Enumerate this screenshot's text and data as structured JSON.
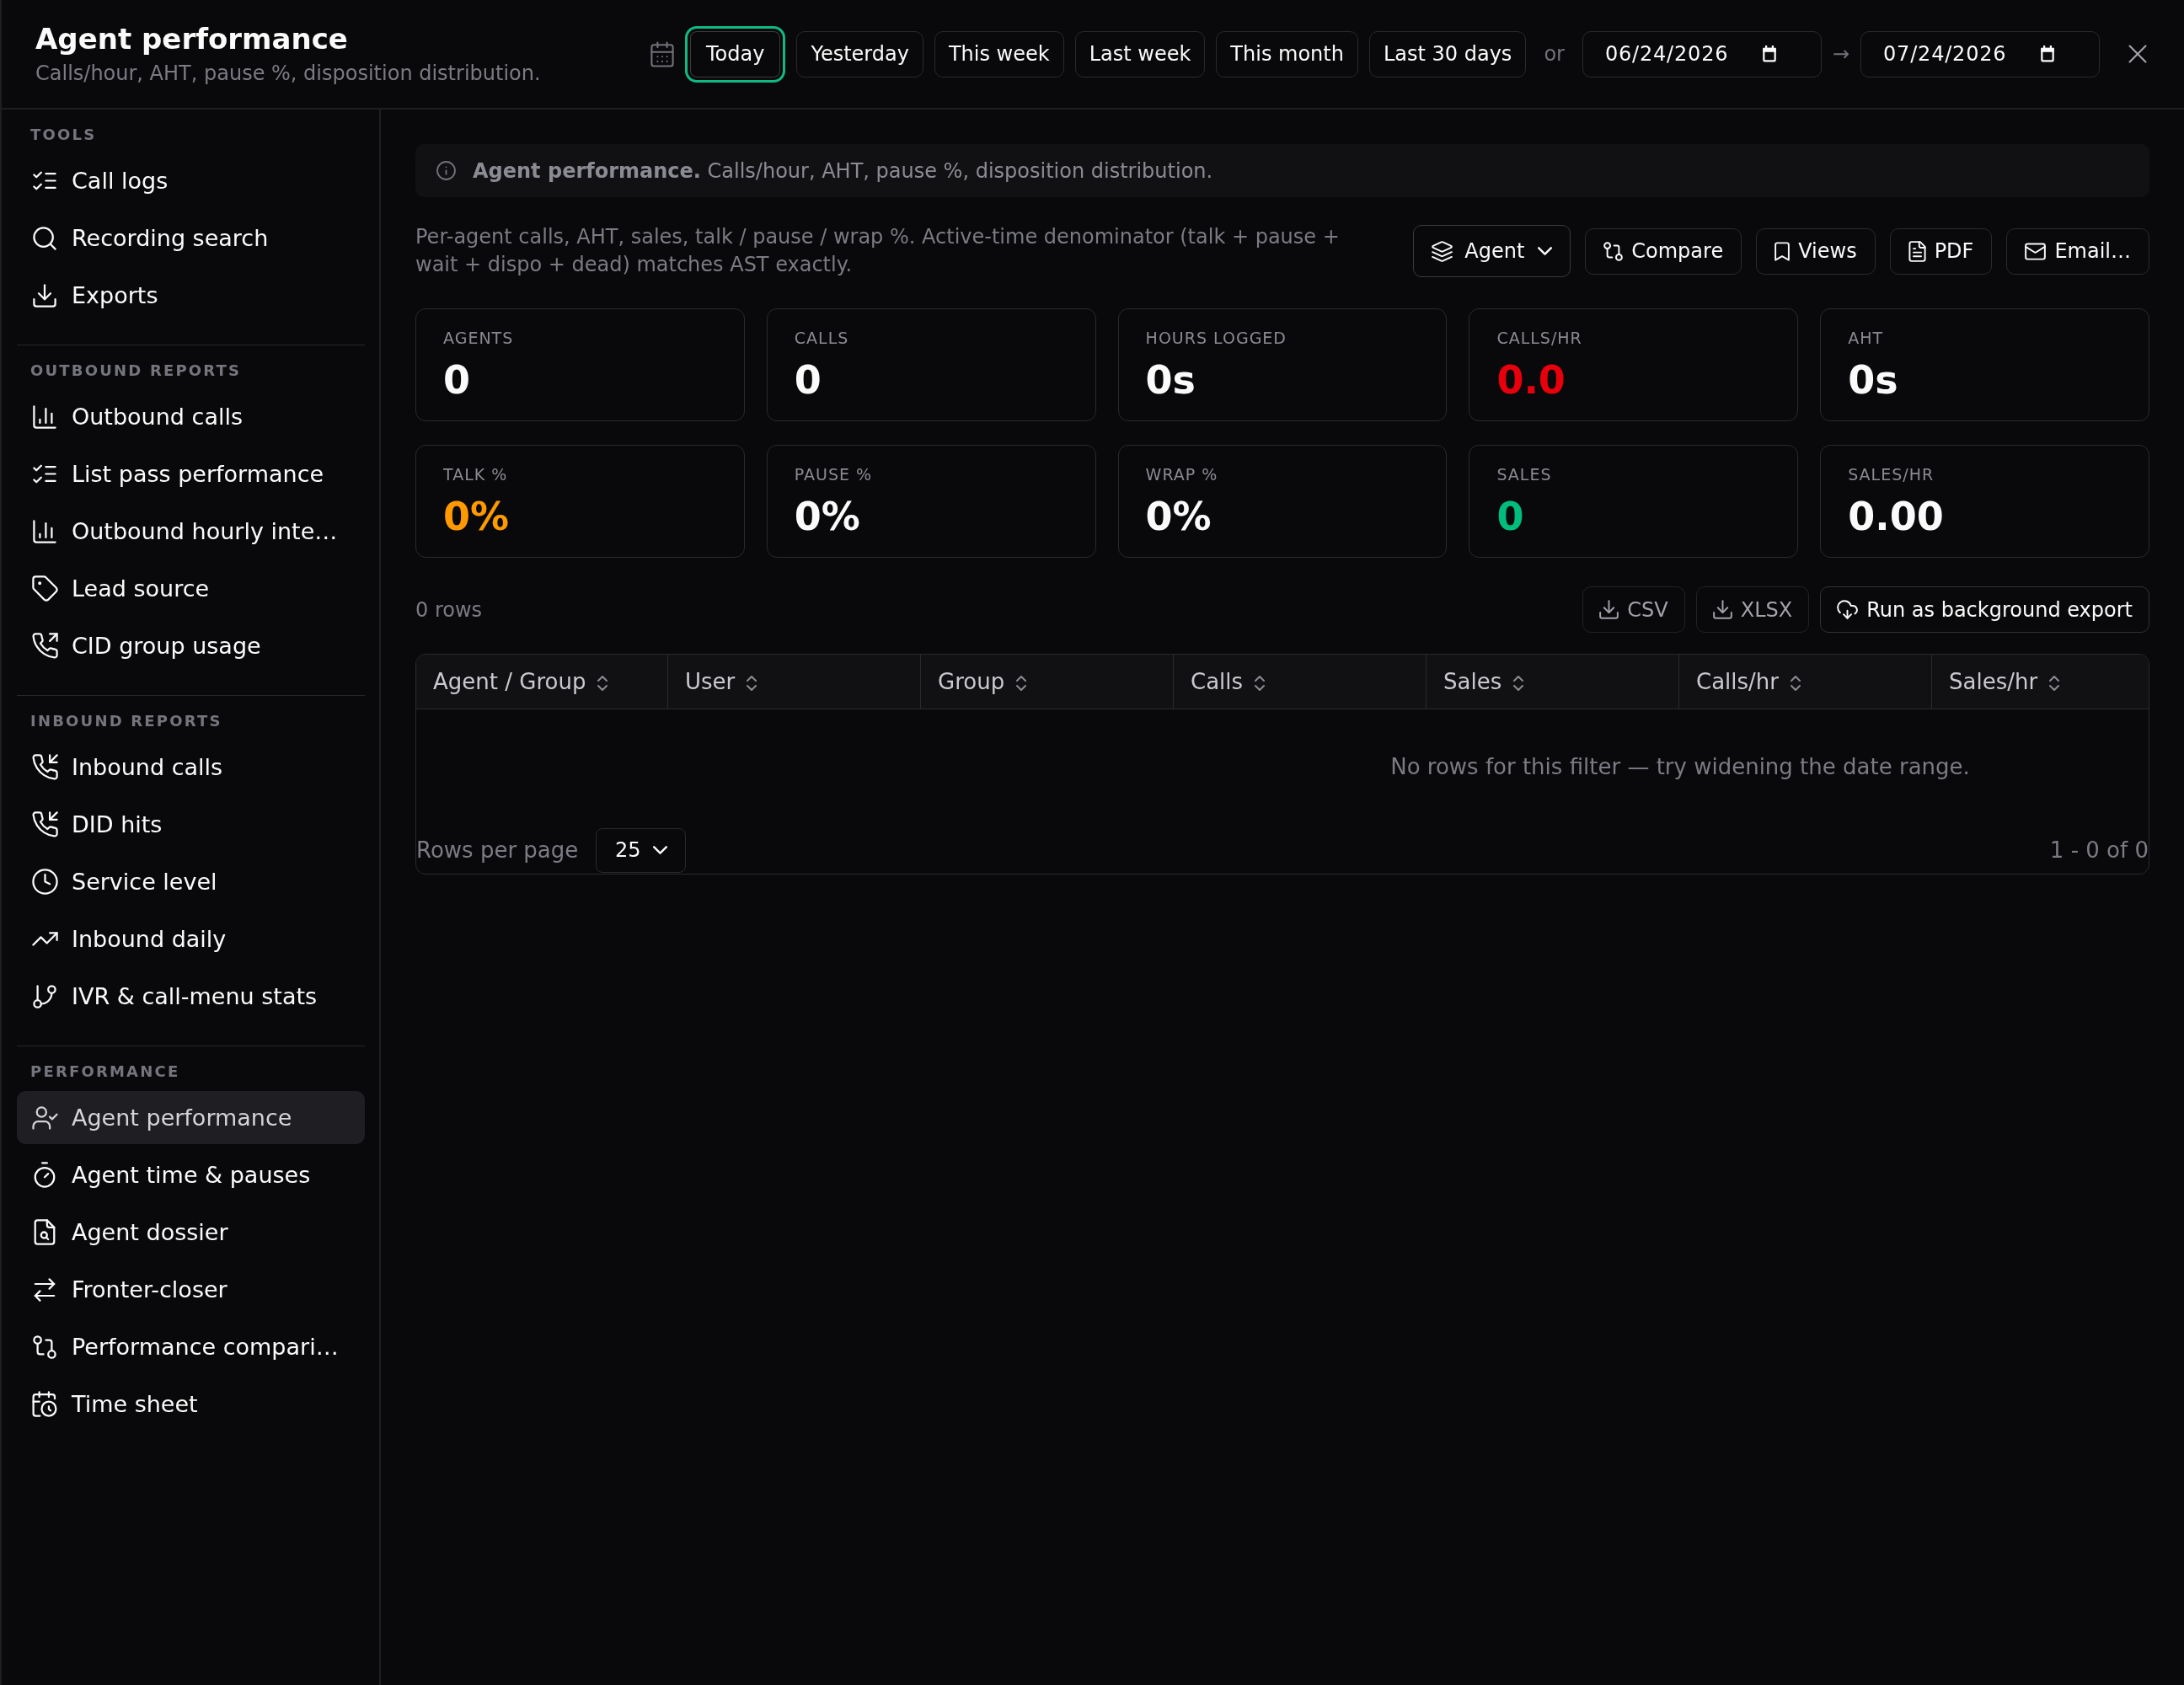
{
  "header": {
    "title": "Agent performance",
    "subtitle": "Calls/hour, AHT, pause %, disposition distribution.",
    "ranges": [
      {
        "label": "Today",
        "selected": true
      },
      {
        "label": "Yesterday",
        "selected": false
      },
      {
        "label": "This week",
        "selected": false
      },
      {
        "label": "Last week",
        "selected": false
      },
      {
        "label": "This month",
        "selected": false
      },
      {
        "label": "Last 30 days",
        "selected": false
      }
    ],
    "or_label": "or",
    "date_from": "06/24/2026",
    "arrow": "→",
    "date_to": "07/24/2026"
  },
  "sidebar": {
    "sections": [
      {
        "title": "TOOLS",
        "items": [
          {
            "label": "Call logs",
            "selected": false
          },
          {
            "label": "Recording search",
            "selected": false
          },
          {
            "label": "Exports",
            "selected": false
          }
        ]
      },
      {
        "title": "OUTBOUND REPORTS",
        "items": [
          {
            "label": "Outbound calls",
            "selected": false
          },
          {
            "label": "List pass performance",
            "selected": false
          },
          {
            "label": "Outbound hourly inte…",
            "selected": false
          },
          {
            "label": "Lead source",
            "selected": false
          },
          {
            "label": "CID group usage",
            "selected": false
          }
        ]
      },
      {
        "title": "INBOUND REPORTS",
        "items": [
          {
            "label": "Inbound calls",
            "selected": false
          },
          {
            "label": "DID hits",
            "selected": false
          },
          {
            "label": "Service level",
            "selected": false
          },
          {
            "label": "Inbound daily",
            "selected": false
          },
          {
            "label": "IVR & call-menu stats",
            "selected": false
          }
        ]
      },
      {
        "title": "PERFORMANCE",
        "items": [
          {
            "label": "Agent performance",
            "selected": true
          },
          {
            "label": "Agent time & pauses",
            "selected": false
          },
          {
            "label": "Agent dossier",
            "selected": false
          },
          {
            "label": "Fronter-closer",
            "selected": false
          },
          {
            "label": "Performance compari…",
            "selected": false
          },
          {
            "label": "Time sheet",
            "selected": false
          }
        ]
      }
    ]
  },
  "banner": {
    "text": "**Agent performance.** Calls/hour, AHT, pause %, disposition distribution."
  },
  "description": "Per-agent calls, AHT, sales, talk / pause / wrap %. Active-time denominator (talk + pause + wait + dispo + dead) matches AST exactly.",
  "toolbar": [
    {
      "label": "Agent",
      "kind": "dropdown"
    },
    {
      "label": "Compare",
      "kind": "button"
    },
    {
      "label": "Views",
      "kind": "button"
    },
    {
      "label": "PDF",
      "kind": "button"
    },
    {
      "label": "Email…",
      "kind": "button"
    }
  ],
  "stats": [
    {
      "label": "AGENTS",
      "value": "0",
      "color": "#fafafa"
    },
    {
      "label": "CALLS",
      "value": "0",
      "color": "#fafafa"
    },
    {
      "label": "HOURS LOGGED",
      "value": "0s",
      "color": "#fafafa"
    },
    {
      "label": "CALLS/HR",
      "value": "0.0",
      "color": "#e7000b"
    },
    {
      "label": "AHT",
      "value": "0s",
      "color": "#fafafa"
    },
    {
      "label": "TALK %",
      "value": "0%",
      "color": "#fe9a00"
    },
    {
      "label": "PAUSE %",
      "value": "0%",
      "color": "#fafafa"
    },
    {
      "label": "WRAP %",
      "value": "0%",
      "color": "#fafafa"
    },
    {
      "label": "SALES",
      "value": "0",
      "color": "#00bc7d"
    },
    {
      "label": "SALES/HR",
      "value": "0.00",
      "color": "#fafafa"
    }
  ],
  "export_bar": {
    "row_count": "0 rows",
    "buttons": [
      {
        "label": "CSV",
        "disabled": true
      },
      {
        "label": "XLSX",
        "disabled": true
      },
      {
        "label": "Run as background export",
        "disabled": false
      }
    ]
  },
  "table": {
    "columns": [
      "Agent / Group",
      "User",
      "Group",
      "Calls",
      "Sales",
      "Calls/hr",
      "Sales/hr"
    ],
    "empty_message": "No rows for this filter — try widening the date range.",
    "rows_per_page_label": "Rows per page",
    "rows_per_page": "25",
    "range": "1 - 0 of 0"
  }
}
